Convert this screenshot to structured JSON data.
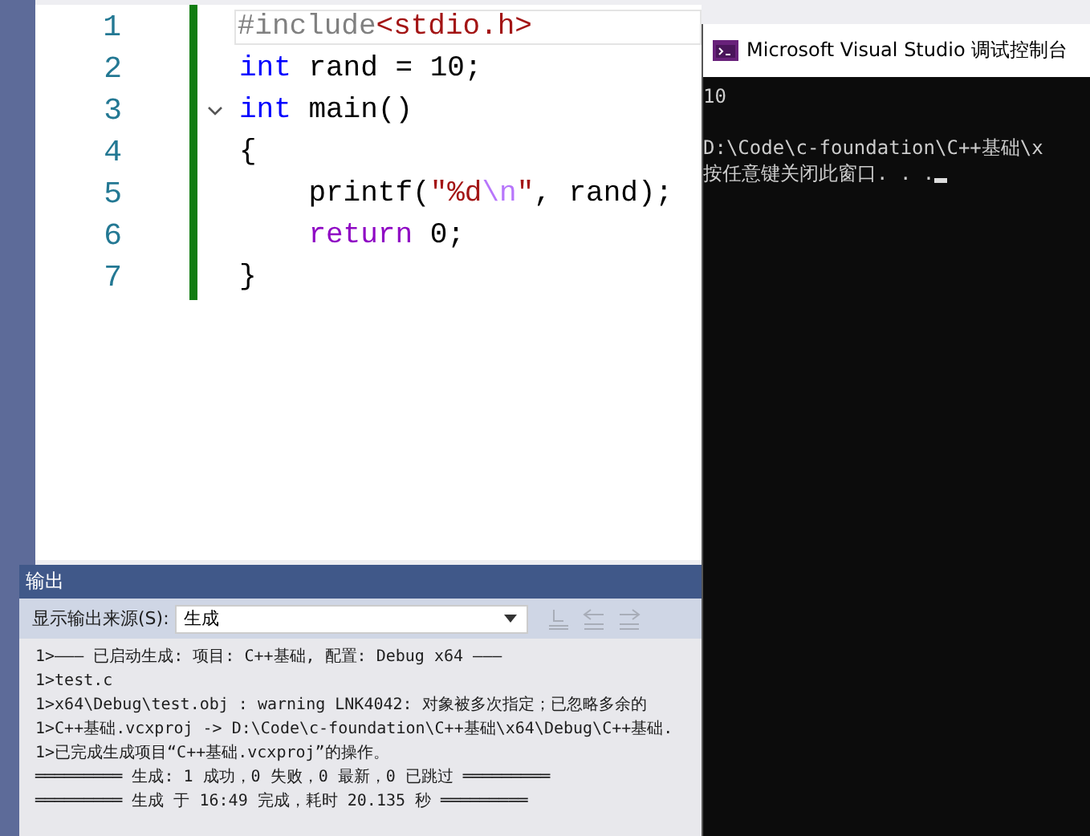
{
  "editor": {
    "lines": [
      {
        "number": "1",
        "current": true,
        "tokens": [
          {
            "text": "#include",
            "kind": "preproc"
          },
          {
            "text": "<stdio.h>",
            "kind": "header"
          }
        ]
      },
      {
        "number": "2",
        "current": false,
        "tokens": [
          {
            "text": "int",
            "kind": "keyword"
          },
          {
            "text": " rand = 10;",
            "kind": "plain"
          }
        ]
      },
      {
        "number": "3",
        "current": false,
        "fold": true,
        "tokens": [
          {
            "text": "int",
            "kind": "keyword"
          },
          {
            "text": " main()",
            "kind": "plain"
          }
        ]
      },
      {
        "number": "4",
        "current": false,
        "tokens": [
          {
            "text": "{",
            "kind": "plain"
          }
        ]
      },
      {
        "number": "5",
        "current": false,
        "tokens": [
          {
            "text": "    printf(",
            "kind": "plain"
          },
          {
            "text": "\"%d",
            "kind": "string"
          },
          {
            "text": "\\n",
            "kind": "escape"
          },
          {
            "text": "\"",
            "kind": "string"
          },
          {
            "text": ", rand);",
            "kind": "plain"
          }
        ]
      },
      {
        "number": "6",
        "current": false,
        "tokens": [
          {
            "text": "    return",
            "kind": "control"
          },
          {
            "text": " 0;",
            "kind": "plain"
          }
        ]
      },
      {
        "number": "7",
        "current": false,
        "tokens": [
          {
            "text": "}",
            "kind": "plain"
          }
        ]
      }
    ]
  },
  "console": {
    "title": "Microsoft Visual Studio 调试控制台",
    "lines": [
      {
        "text": "10",
        "blank_before": false,
        "cursor": false
      },
      {
        "text": "D:\\Code\\c-foundation\\C++基础\\x",
        "blank_before": true,
        "cursor": false
      },
      {
        "text": "按任意键关闭此窗口. . .",
        "blank_before": false,
        "cursor": true
      }
    ]
  },
  "output": {
    "title": "输出",
    "source_label": "显示输出来源(S):",
    "source_value": "生成",
    "lines": [
      "1>——— 已启动生成: 项目: C++基础, 配置: Debug x64 ———",
      "1>test.c",
      "1>x64\\Debug\\test.obj : warning LNK4042: 对象被多次指定；已忽略多余的",
      "1>C++基础.vcxproj -> D:\\Code\\c-foundation\\C++基础\\x64\\Debug\\C++基础.",
      "1>已完成生成项目“C++基础.vcxproj”的操作。",
      "═════════ 生成: 1 成功，0 失败，0 最新，0 已跳过 ═════════",
      "═════════ 生成 于 16:49 完成，耗时 20.135 秒 ═════════"
    ]
  }
}
